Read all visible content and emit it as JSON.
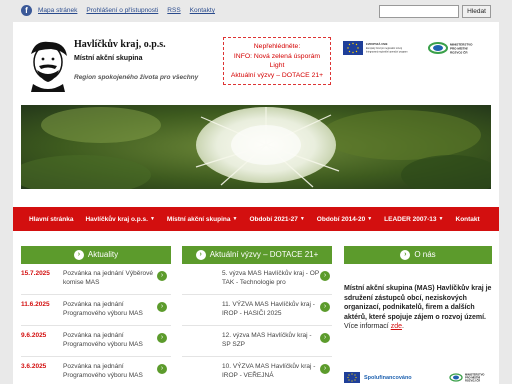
{
  "topbar": {
    "links": [
      "Mapa stránek",
      "Prohlášení o přístupnosti",
      "RSS",
      "Kontakty"
    ],
    "search_button": "Hledat",
    "search_value": ""
  },
  "header": {
    "title": "Havlíčkův kraj, o.p.s.",
    "subtitle": "Místní akční skupina",
    "tagline": "Region spokojeného života pro všechny",
    "notice_lines": [
      "Nepřehlédněte:",
      "INFO: Nová zelená úsporám",
      "Light",
      "Aktuální výzvy – DOTACE 21+"
    ],
    "eu_logo_text": [
      "EVROPSKÁ UNIE",
      "Evropský fond pro regionální rozvoj",
      "Integrovaný regionální operační program"
    ],
    "ministry_logo_text": [
      "MINISTERSTVO",
      "PRO MÍSTNÍ",
      "ROZVOJ ČR"
    ]
  },
  "nav": {
    "items": [
      {
        "label": "Hlavní stránka",
        "dropdown": false
      },
      {
        "label": "Havlíčkův kraj o.p.s.",
        "dropdown": true
      },
      {
        "label": "Místní akční skupina",
        "dropdown": true
      },
      {
        "label": "Období 2021-27",
        "dropdown": true
      },
      {
        "label": "Období 2014-20",
        "dropdown": true
      },
      {
        "label": "LEADER 2007-13",
        "dropdown": true
      },
      {
        "label": "Kontakt",
        "dropdown": false
      }
    ]
  },
  "aktuality": {
    "heading": "Aktuality",
    "items": [
      {
        "date": "15.7.2025",
        "text": "Pozvánka na jednání Výběrové komise MAS"
      },
      {
        "date": "11.6.2025",
        "text": "Pozvánka na jednání Programového výboru MAS"
      },
      {
        "date": "9.6.2025",
        "text": "Pozvánka na jednání Programového výboru MAS"
      },
      {
        "date": "3.6.2025",
        "text": "Pozvánka na jednání Programového výboru MAS"
      }
    ]
  },
  "vyzvy": {
    "heading": "Aktuální výzvy – DOTACE 21+",
    "items": [
      {
        "text": "5. výzva MAS Havlíčkův kraj - OP TAK - Technologie pro"
      },
      {
        "text": "11. VÝZVA MAS Havlíčkův kraj - IROP - HASIČI 2025"
      },
      {
        "text": "12. výzva MAS Havlíčkův kraj - SP SZP"
      },
      {
        "text": "10. VÝZVA MAS Havlíčkův kraj - IROP - VEŘEJNÁ"
      }
    ]
  },
  "o_nas": {
    "heading": "O nás",
    "bold_text": "Místní akční skupina (MAS) Havlíčkův kraj je sdružení zástupců obcí, neziskových organizací, podnikatelů, firem a dalších aktérů, které spojuje zájem o rozvoj území.",
    "more_text": " Více informací ",
    "link_text": "zde",
    "after_link": ".",
    "cofinanced": "Spolufinancováno"
  },
  "colors": {
    "nav_red": "#d30f0f",
    "section_green": "#5c9b2c",
    "notice_red": "#d40000"
  }
}
